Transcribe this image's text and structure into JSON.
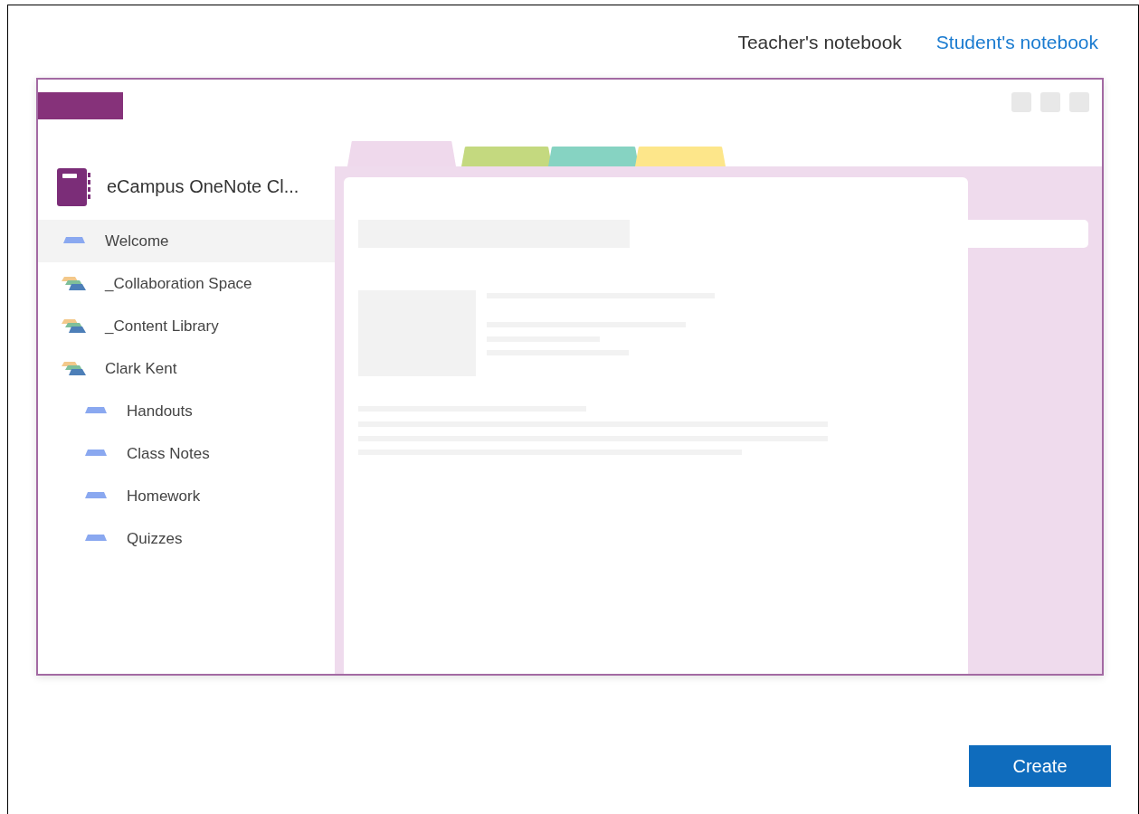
{
  "view_tabs": [
    {
      "label": "Teacher's notebook",
      "selected": true
    },
    {
      "label": "Student's notebook",
      "selected": false
    }
  ],
  "preview": {
    "notebook": {
      "title": "eCampus OneNote Cl..."
    },
    "sidebar": {
      "items": [
        {
          "kind": "section",
          "label": "Welcome",
          "selected": true
        },
        {
          "kind": "group",
          "label": "_Collaboration Space",
          "selected": false
        },
        {
          "kind": "group",
          "label": "_Content Library",
          "selected": false
        },
        {
          "kind": "group",
          "label": "Clark Kent",
          "selected": false,
          "children": [
            {
              "kind": "section",
              "label": "Handouts",
              "selected": false
            },
            {
              "kind": "section",
              "label": "Class Notes",
              "selected": false
            },
            {
              "kind": "section",
              "label": "Homework",
              "selected": false
            },
            {
              "kind": "section",
              "label": "Quizzes",
              "selected": false
            }
          ]
        }
      ]
    },
    "section_tabs": [
      {
        "color": "#efd9ec",
        "selected": true
      },
      {
        "color": "#c4d97f",
        "selected": false
      },
      {
        "color": "#86d3c2",
        "selected": false
      },
      {
        "color": "#fde68a",
        "selected": false
      }
    ]
  },
  "buttons": [
    {
      "label": "Create"
    }
  ]
}
